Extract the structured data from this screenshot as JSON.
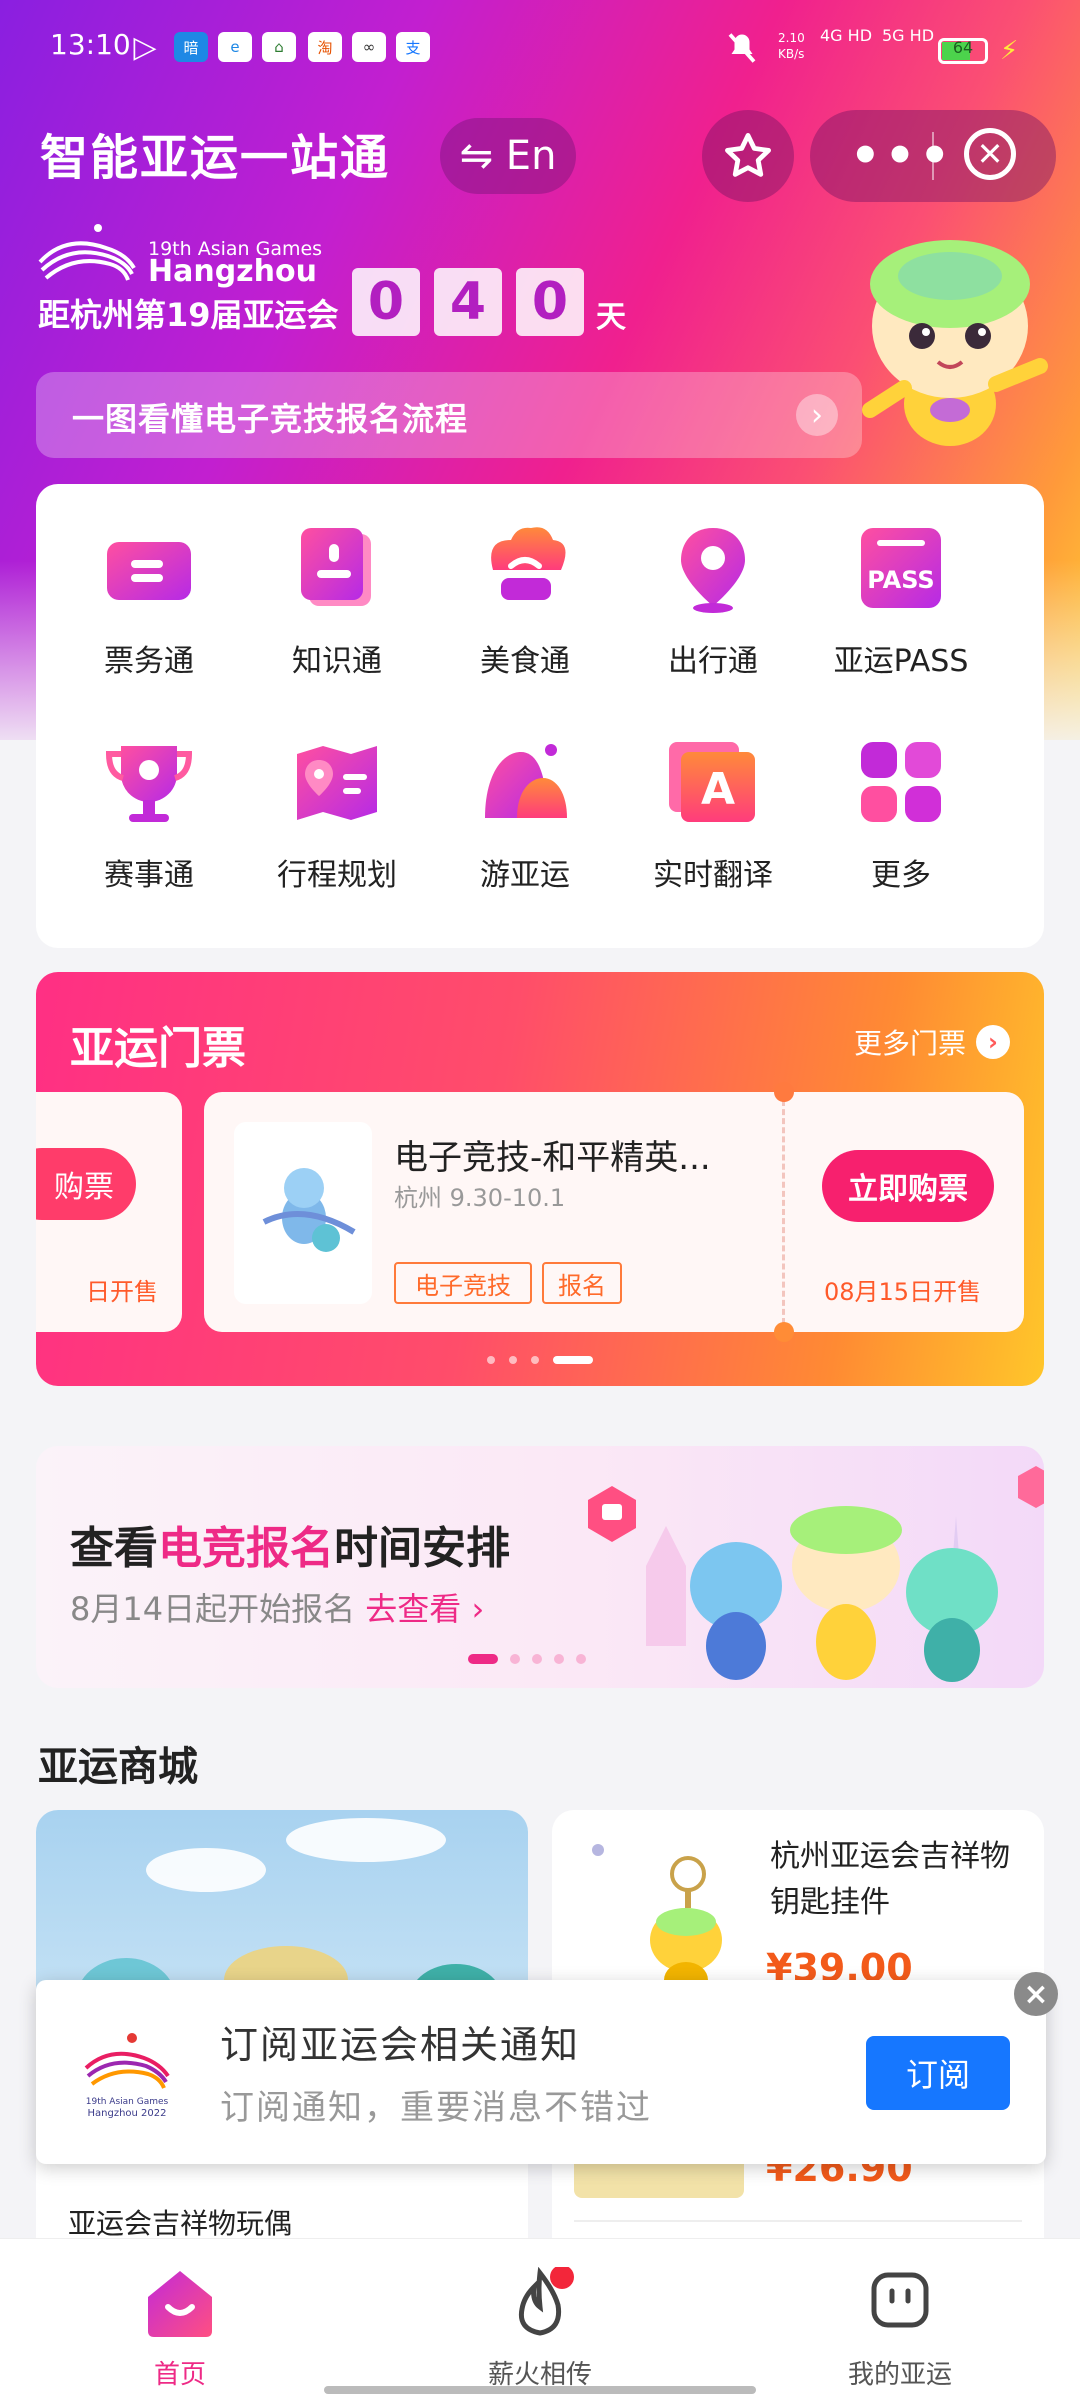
{
  "status_bar": {
    "time": "13:10",
    "apps": [
      "▷",
      "暗",
      "e",
      "⌂",
      "淘",
      "∞",
      "支"
    ],
    "speed": "2.10\nKB/s",
    "net1": "4G HD",
    "net2": "5G HD",
    "battery": "64"
  },
  "header": {
    "title": "智能亚运一站通",
    "lang_button": "⇋ En",
    "star_icon": "star-icon",
    "more_label": "•••",
    "close_label": "✕",
    "logo_line1": "19th Asian Games",
    "logo_line2": "Hangzhou",
    "countdown_label": "距杭州第19届亚运会",
    "countdown_digits": [
      "0",
      "4",
      "0"
    ],
    "countdown_unit": "天",
    "guide_banner": "一图看懂电子竞技报名流程",
    "guide_arrow": "›"
  },
  "services": [
    {
      "label": "票务通",
      "icon": "ticket-icon"
    },
    {
      "label": "知识通",
      "icon": "book-icon"
    },
    {
      "label": "美食通",
      "icon": "chef-hat-icon"
    },
    {
      "label": "出行通",
      "icon": "location-icon"
    },
    {
      "label": "亚运PASS",
      "icon": "pass-icon"
    },
    {
      "label": "赛事通",
      "icon": "trophy-icon"
    },
    {
      "label": "行程规划",
      "icon": "map-icon"
    },
    {
      "label": "游亚运",
      "icon": "mountain-icon"
    },
    {
      "label": "实时翻译",
      "icon": "translate-icon"
    },
    {
      "label": "更多",
      "icon": "grid-icon"
    }
  ],
  "tickets": {
    "title": "亚运门票",
    "more": "更多门票",
    "prev_card": {
      "button": "购票",
      "sale": "日开售"
    },
    "card": {
      "name": "电子竞技-和平精英...",
      "date": "杭州 9.30-10.1",
      "tags": [
        "电子竞技",
        "报名"
      ],
      "button": "立即购票",
      "sale": "08月15日开售"
    }
  },
  "promo": {
    "title_pre": "查看",
    "title_hl": "电竞报名",
    "title_post": "时间安排",
    "sub_pre": "8月14日起开始报名",
    "sub_link": "去查看 ›"
  },
  "mall": {
    "title": "亚运商城",
    "left_name": "亚运会吉祥物玩偶",
    "right_name": "杭州亚运会吉祥物钥匙挂件",
    "right_price1": "¥39.00",
    "right_price2": "¥26.90"
  },
  "subscribe": {
    "title": "订阅亚运会相关通知",
    "subtitle": "订阅通知，重要消息不错过",
    "button": "订阅",
    "close": "×",
    "logo_line1": "19th Asian Games",
    "logo_line2": "Hangzhou 2022"
  },
  "tabbar": {
    "home": "首页",
    "fire": "薪火相传",
    "mine": "我的亚运"
  },
  "colors": {
    "brand_pink": "#ee2a86",
    "accent_orange": "#f35a1a",
    "subscribe_blue": "#1677ff"
  }
}
